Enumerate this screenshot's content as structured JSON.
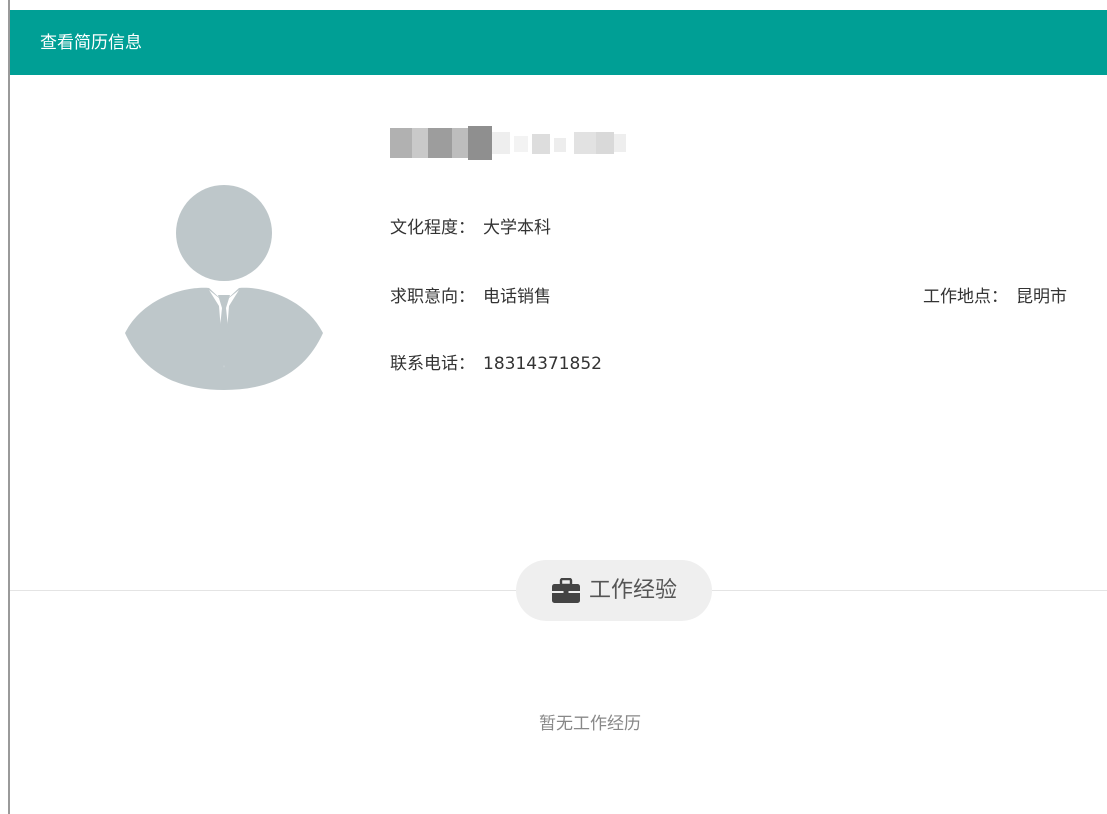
{
  "window": {
    "title": "查看简历信息",
    "accent_color": "#009f95"
  },
  "profile": {
    "avatar_icon": "person-silhouette-icon",
    "name_redacted": true,
    "education": {
      "label": "文化程度：",
      "value": "大学本科"
    },
    "job_intention": {
      "label": "求职意向：",
      "value": "电话销售"
    },
    "work_location": {
      "label": "工作地点：",
      "value": "昆明市"
    },
    "phone": {
      "label": "联系电话：",
      "value": "18314371852"
    }
  },
  "work_experience": {
    "section_title": "工作经验",
    "section_icon": "briefcase-icon",
    "empty_text": "暂无工作经历"
  }
}
